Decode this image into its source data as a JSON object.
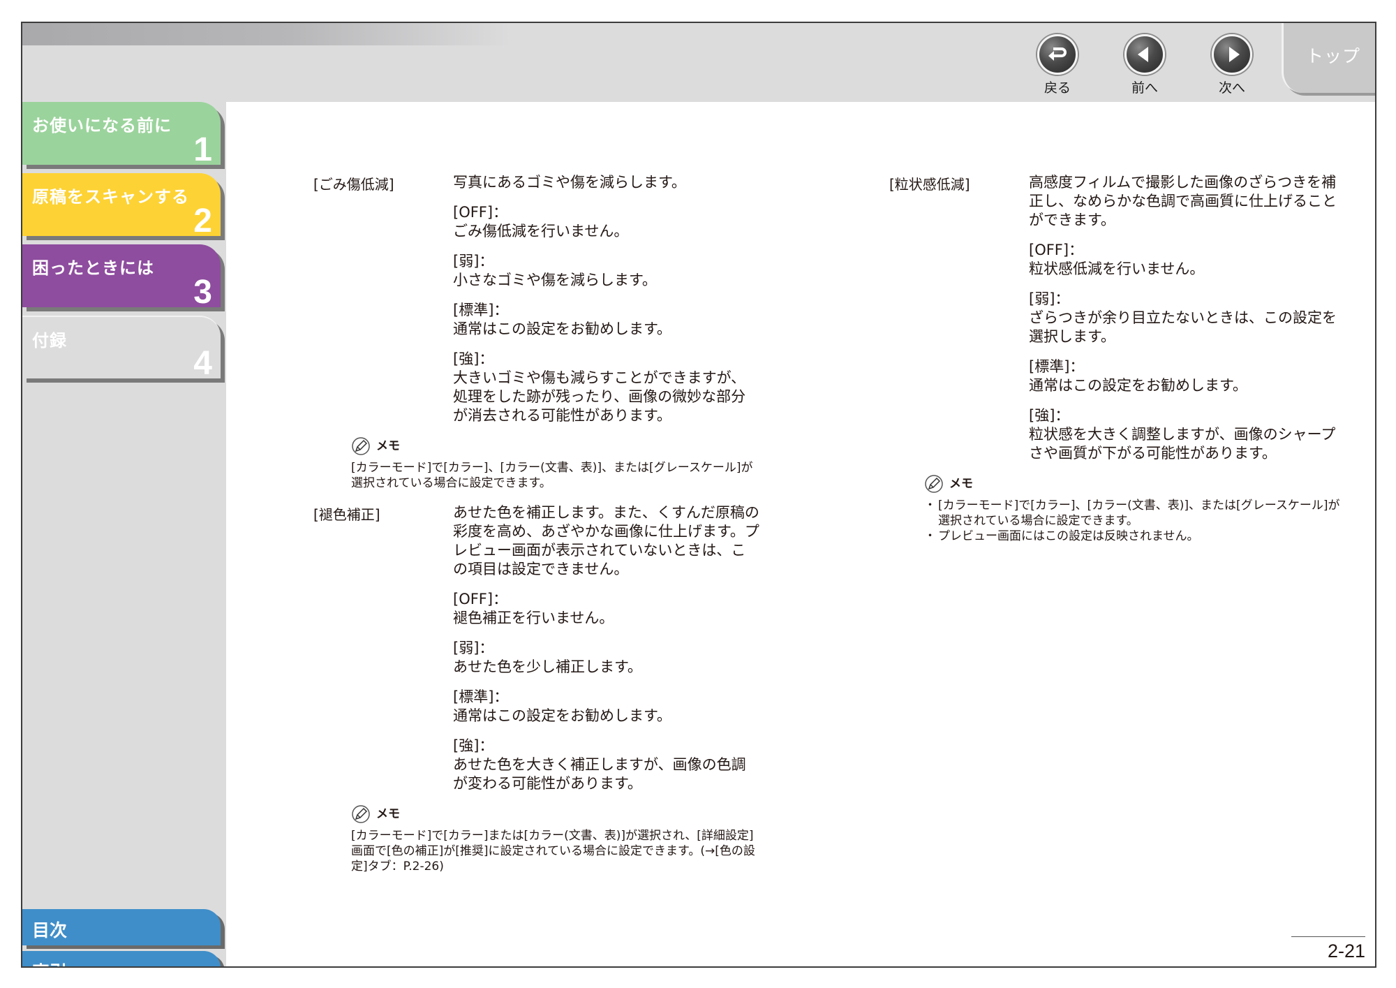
{
  "header": {
    "nav": {
      "back_label": "戻る",
      "prev_label": "前へ",
      "next_label": "次へ",
      "top_label": "トップ"
    }
  },
  "sidebar": {
    "chapters": [
      {
        "title": "お使いになる前に",
        "num": "1",
        "color": "#9bd39c"
      },
      {
        "title": "原稿をスキャンする",
        "num": "2",
        "color": "#fdd234"
      },
      {
        "title": "困ったときには",
        "num": "3",
        "color": "#8e4d9e"
      },
      {
        "title": "付録",
        "num": "4",
        "color": "#dcdcdd"
      }
    ],
    "toc_label": "目次",
    "index_label": "索引"
  },
  "left": {
    "dust": {
      "term": "[ごみ傷低減]",
      "intro": "写真にあるゴミや傷を減らします。",
      "opts": [
        {
          "label": "[OFF]：",
          "text": "ごみ傷低減を行いません。"
        },
        {
          "label": "[弱]：",
          "text": "小さなゴミや傷を減らします。"
        },
        {
          "label": "[標準]：",
          "text": "通常はこの設定をお勧めします。"
        },
        {
          "label": "[強]：",
          "text": "大きいゴミや傷も減らすことができますが、処理をした跡が残ったり、画像の微妙な部分が消去される可能性があります。"
        }
      ],
      "memo_title": "メモ",
      "memo_text": "[カラーモード]で[カラー]、[カラー(文書、表)]、または[グレースケール]が選択されている場合に設定できます。"
    },
    "fade": {
      "term": "[褪色補正]",
      "intro": "あせた色を補正します。また、くすんだ原稿の彩度を高め、あざやかな画像に仕上げます。プレビュー画面が表示されていないときは、この項目は設定できません。",
      "opts": [
        {
          "label": "[OFF]：",
          "text": "褪色補正を行いません。"
        },
        {
          "label": "[弱]：",
          "text": "あせた色を少し補正します。"
        },
        {
          "label": "[標準]：",
          "text": "通常はこの設定をお勧めします。"
        },
        {
          "label": "[強]：",
          "text": "あせた色を大きく補正しますが、画像の色調が変わる可能性があります。"
        }
      ],
      "memo_title": "メモ",
      "memo_text": "[カラーモード]で[カラー]または[カラー(文書、表)]が選択され、[詳細設定]画面で[色の補正]が[推奨]に設定されている場合に設定できます。(→[色の設定]タブ：P.2-26)"
    }
  },
  "right": {
    "grain": {
      "term": "[粒状感低減]",
      "intro": "高感度フィルムで撮影した画像のざらつきを補正し、なめらかな色調で高画質に仕上げることができます。",
      "opts": [
        {
          "label": "[OFF]：",
          "text": "粒状感低減を行いません。"
        },
        {
          "label": "[弱]：",
          "text": "ざらつきが余り目立たないときは、この設定を選択します。"
        },
        {
          "label": "[標準]：",
          "text": "通常はこの設定をお勧めします。"
        },
        {
          "label": "[強]：",
          "text": "粒状感を大きく調整しますが、画像のシャープさや画質が下がる可能性があります。"
        }
      ],
      "memo_title": "メモ",
      "memo_items": [
        "[カラーモード]で[カラー]、[カラー(文書、表)]、または[グレースケール]が選択されている場合に設定できます。",
        "プレビュー画面にはこの設定は反映されません。"
      ]
    }
  },
  "page_number": "2-21"
}
